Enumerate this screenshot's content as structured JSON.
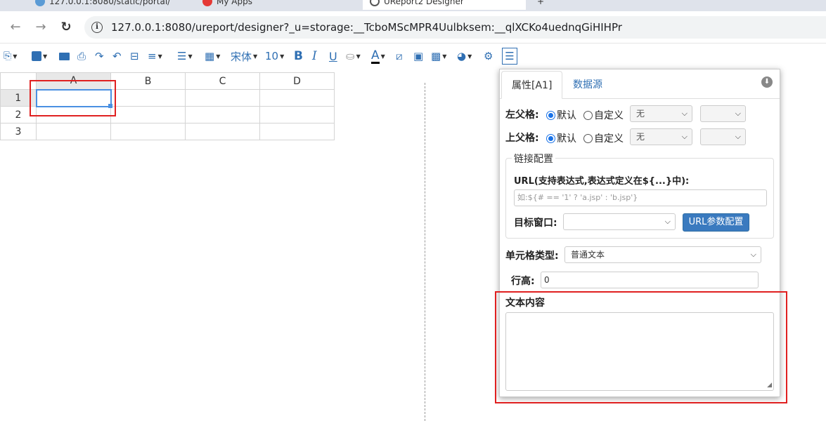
{
  "browser": {
    "tabs": [
      {
        "label": "127.0.0.1:8080/static/portal/",
        "active": false
      },
      {
        "label": "My Apps",
        "active": false
      },
      {
        "label": "UReport2 Designer",
        "active": true
      }
    ],
    "url": "127.0.0.1:8080/ureport/designer?_u=storage:__TcboMScMPR4Uulbksem:__qlXCKo4uednqGiHIHPr"
  },
  "toolbar": {
    "font_name": "宋体",
    "font_size": "10",
    "bold": "B",
    "italic": "I",
    "underline": "U",
    "font_color": "A"
  },
  "sheet": {
    "columns": [
      "A",
      "B",
      "C",
      "D"
    ],
    "rows": [
      "1",
      "2",
      "3"
    ],
    "selected_cell": "A1"
  },
  "panel": {
    "tabs": {
      "properties": "属性[A1]",
      "datasource": "数据源"
    },
    "left_parent": {
      "label": "左父格:",
      "opt_default": "默认",
      "opt_custom": "自定义",
      "select_value": "无",
      "select2_value": ""
    },
    "top_parent": {
      "label": "上父格:",
      "opt_default": "默认",
      "opt_custom": "自定义",
      "select_value": "无",
      "select2_value": ""
    },
    "link": {
      "legend": "链接配置",
      "url_label": "URL(支持表达式,表达式定义在${...}中):",
      "url_placeholder": "如:${# == '1' ? 'a.jsp' : 'b.jsp'}",
      "target_label": "目标窗口:",
      "target_value": "",
      "param_button": "URL参数配置"
    },
    "cell_type": {
      "label": "单元格类型:",
      "value": "普通文本"
    },
    "row_height": {
      "label": "行高:",
      "value": "0"
    },
    "text_content": {
      "label": "文本内容",
      "value": ""
    }
  },
  "colors": {
    "accent": "#2f6fb3",
    "highlight": "#e02020",
    "selection": "#4a90e2"
  }
}
